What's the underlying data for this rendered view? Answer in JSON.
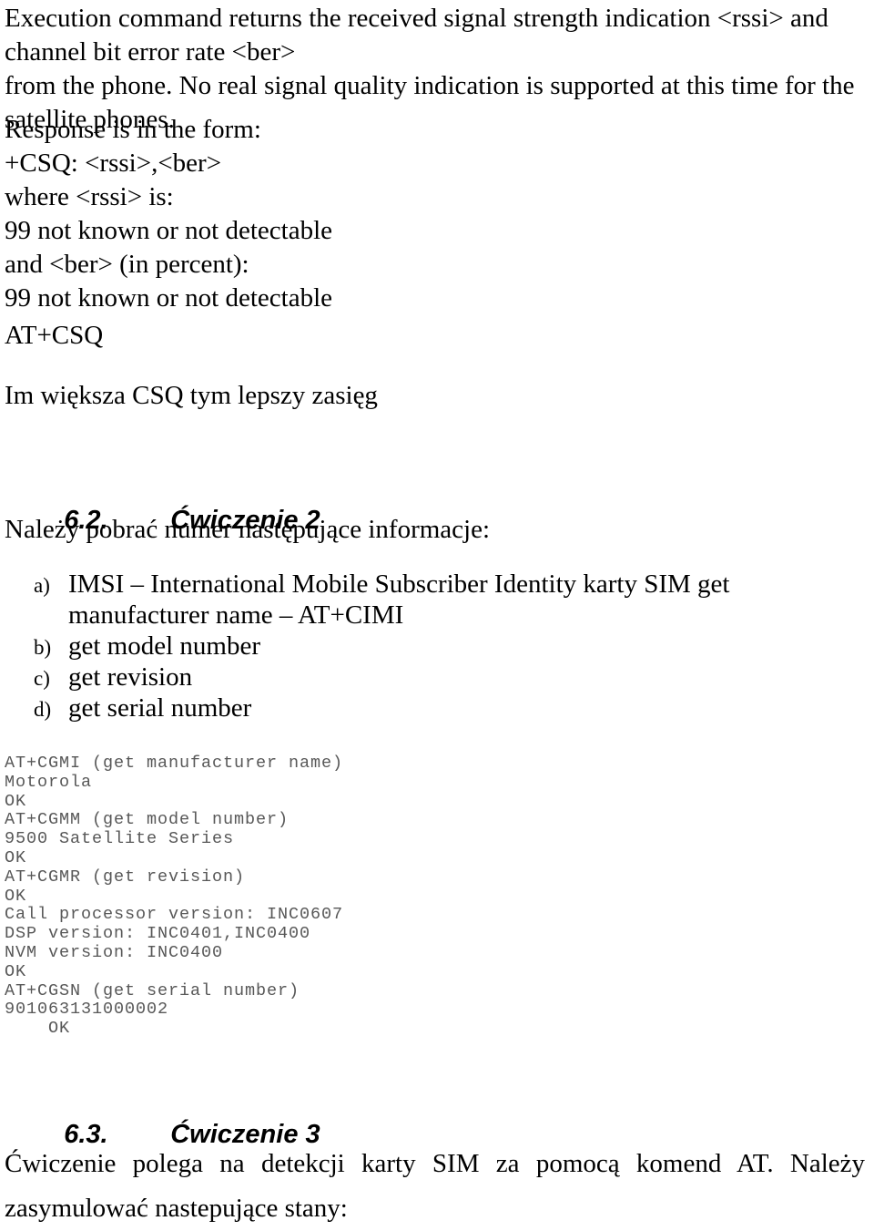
{
  "document": {
    "intro_paragraph": {
      "lines": [
        "Execution command returns the received signal strength indication <rssi> and",
        "channel bit error rate <ber>",
        "from the phone. No real signal quality indication is supported at this time for the",
        "satellite phones."
      ]
    },
    "response_block": {
      "lines": [
        "Response is in the form:",
        "+CSQ: <rssi>,<ber>",
        "where <rssi> is:",
        "99 not known or not detectable",
        "and <ber> (in percent):",
        "99 not known or not detectable"
      ]
    },
    "at_csq_command": "AT+CSQ",
    "csq_note": "Im większa CSQ tym lepszy zasięg",
    "section_62": {
      "number": "6.2.",
      "title": "Ćwiczenie 2",
      "lead_in": "Należy pobrać numer następujące informacje:",
      "items": [
        {
          "marker": "a)",
          "text": "IMSI – International Mobile Subscriber Identity karty SIM get manufacturer name – AT+CIMI"
        },
        {
          "marker": "b)",
          "text": "get model number"
        },
        {
          "marker": "c)",
          "text": "get revision"
        },
        {
          "marker": "d)",
          "text": "get serial number"
        }
      ],
      "terminal_transcript": "AT+CGMI (get manufacturer name)\nMotorola\nOK\nAT+CGMM (get model number)\n9500 Satellite Series\nOK\nAT+CGMR (get revision)\nOK\nCall processor version: INC0607\nDSP version: INC0401,INC0400\nNVM version: INC0400\nOK\nAT+CGSN (get serial number)\n901063131000002\n    OK"
    },
    "section_63": {
      "number": "6.3.",
      "title": "Ćwiczenie 3",
      "paragraph_lines": [
        "Ćwiczenie polega na detekcji karty SIM za pomocą komend AT.    Należy",
        "zasymulować nastepujące stany:"
      ]
    },
    "colors": {
      "text": "#000000",
      "terminal_text": "#585858",
      "page_background": "#ffffff"
    }
  }
}
